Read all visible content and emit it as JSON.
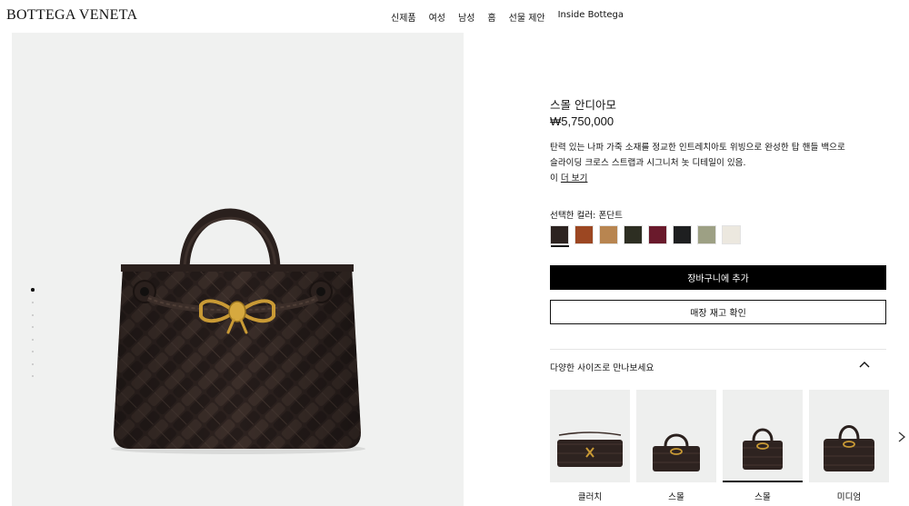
{
  "header": {
    "brand": "BOTTEGA VENETA",
    "nav": [
      "신제품",
      "여성",
      "남성",
      "홈",
      "선물 제안",
      "Inside Bottega"
    ]
  },
  "gallery": {
    "image_count": 8,
    "active_index": 0
  },
  "product": {
    "title": "스몰 안디아모",
    "price": "₩5,750,000",
    "description_lines": [
      "탄력 있는 나파 가죽 소재를 정교한 인트레치아토 위빙으로 완성한 탑 핸들 백으로",
      "슬라이딩 크로스 스트랩과 시그니처 놋 디테일이 있음."
    ],
    "more_prefix": "이",
    "more_link": "더 보기",
    "color_label": "선택한 컬러: 폰단트",
    "swatches": [
      {
        "color": "#2c2320",
        "selected": true
      },
      {
        "color": "#9c4722"
      },
      {
        "color": "#b88550"
      },
      {
        "color": "#2d2e22"
      },
      {
        "color": "#6a1a2c"
      },
      {
        "color": "#1e1f20"
      },
      {
        "color": "#9da084"
      },
      {
        "color": "#ece8df"
      }
    ],
    "add_to_cart": "장바구니에 추가",
    "check_stock": "매장 재고 확인",
    "sizes_title": "다양한 사이즈로 만나보세요",
    "sizes": [
      {
        "label": "클러치",
        "shape": "clutch"
      },
      {
        "label": "스몰",
        "shape": "tote-a"
      },
      {
        "label": "스몰",
        "shape": "tote-b",
        "selected": true
      },
      {
        "label": "미디엄",
        "shape": "medium"
      }
    ]
  },
  "colors": {
    "bag_leather": "#2e2320",
    "hardware_gold": "#c99a35",
    "gallery_bg": "#f0f1f0",
    "primary_button": "#000000"
  }
}
